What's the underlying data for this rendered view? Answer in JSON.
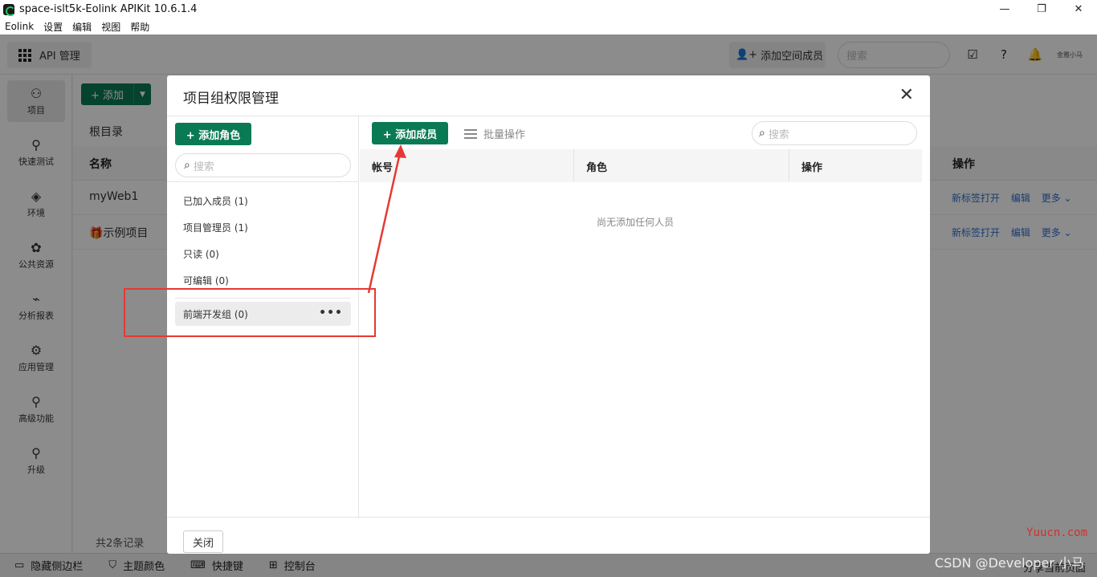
{
  "window": {
    "title": "space-islt5k-Eolink APIKit 10.6.1.4",
    "controls": {
      "minimize": "—",
      "maximize": "❐",
      "close": "✕"
    }
  },
  "menubar": [
    "Eolink",
    "设置",
    "编辑",
    "视图",
    "帮助"
  ],
  "topbar": {
    "api_label": "API 管理",
    "add_member_label": "添加空间成员",
    "search_placeholder": "搜索",
    "avatar_text": "金雅小马"
  },
  "sidebar": [
    {
      "label": "项目",
      "icon": "ai-project-icon",
      "glyph": "⚇"
    },
    {
      "label": "快速测试",
      "icon": "rocket-icon",
      "glyph": "⚲"
    },
    {
      "label": "环境",
      "icon": "cube-icon",
      "glyph": "◈"
    },
    {
      "label": "公共资源",
      "icon": "puzzle-icon",
      "glyph": "✿"
    },
    {
      "label": "分析报表",
      "icon": "chart-icon",
      "glyph": "⌁"
    },
    {
      "label": "应用管理",
      "icon": "gear-icon",
      "glyph": "⚙"
    },
    {
      "label": "高级功能",
      "icon": "rocket-icon",
      "glyph": "⚲"
    },
    {
      "label": "升级",
      "icon": "rocket-icon",
      "glyph": "⚲"
    }
  ],
  "content": {
    "add_label": "+ 添加",
    "root_dir": "根目录",
    "col_name": "名称",
    "col_ops": "操作",
    "rows": [
      {
        "name": "myWeb1",
        "ops": [
          "新标签打开",
          "编辑",
          "更多 ⌄"
        ]
      },
      {
        "name": "🎁示例项目",
        "ops": [
          "新标签打开",
          "编辑",
          "更多 ⌄"
        ]
      }
    ],
    "footer_count": "共2条记录"
  },
  "bottombar": {
    "items": [
      "隐藏侧边栏",
      "主题颜色",
      "快捷键",
      "控制台"
    ],
    "right": "分享当前页面"
  },
  "modal": {
    "title": "项目组权限管理",
    "close_glyph": "✕",
    "add_role_label": "+ 添加角色",
    "left_search_placeholder": "搜索",
    "roles": [
      "已加入成员 (1)",
      "项目管理员 (1)",
      "只读 (0)",
      "可编辑 (0)"
    ],
    "custom_group": "前端开发组 (0)",
    "more_glyph": "•••",
    "add_member_label": "+ 添加成员",
    "batch_label": "批量操作",
    "right_search_placeholder": "搜索",
    "table_headers": [
      "帐号",
      "角色",
      "操作"
    ],
    "empty_text": "尚无添加任何人员",
    "close_button_label": "关闭"
  },
  "watermark": "Yuucn.com",
  "watermark2": "CSDN @Developer 小马",
  "colors": {
    "primary": "#0a7a55",
    "link": "#2f6fd0",
    "annotation": "#e53935"
  }
}
